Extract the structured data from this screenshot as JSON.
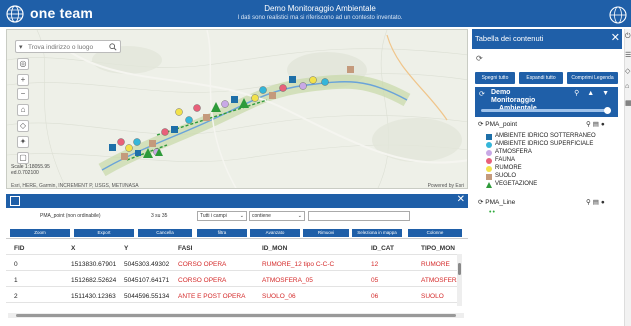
{
  "header": {
    "brand": "one team",
    "title": "Demo Monitoraggio Ambientale",
    "subtitle": "I dati sono realistici ma si riferiscono ad un contesto inventato."
  },
  "map": {
    "search_placeholder": "Trova indirizzo o luogo",
    "scale_text": "Scale 1:18055.95",
    "scale_sub": "ed.0.702100",
    "attribution": "Esri, HERE, Garmin, INCREMENT P, USGS, METI/NASA",
    "powered_by": "Powered by Esri"
  },
  "toc": {
    "title": "Tabella dei contenuti",
    "buttons": [
      "Spegni tutto",
      "Espandi tutto",
      "Comprimi Legenda"
    ],
    "group_name_line1": "Demo Monitoraggio",
    "group_name_line2": "Ambientale",
    "point_layer": "PMA_point",
    "line_layer": "PMA_Line",
    "legend": [
      {
        "label": "AMBIENTE IDRICO SOTTERRANEO",
        "color": "#1e6fa8",
        "shape": "square"
      },
      {
        "label": "AMBIENTE IDRICO SUPERFICIALE",
        "color": "#35b6d9",
        "shape": "circle"
      },
      {
        "label": "ATMOSFERA",
        "color": "#c9a9e6",
        "shape": "circle"
      },
      {
        "label": "FAUNA",
        "color": "#e8607a",
        "shape": "circle"
      },
      {
        "label": "RUMORE",
        "color": "#f2e24b",
        "shape": "circle"
      },
      {
        "label": "SUOLO",
        "color": "#c49a7c",
        "shape": "square"
      },
      {
        "label": "VEGETAZIONE",
        "color": "#2e9a3a",
        "shape": "triangle"
      }
    ]
  },
  "attr": {
    "layer_label": "PMA_point (non ordinabile)",
    "count": "3 su 35",
    "select_fields": "Tutti i campi",
    "select_op": "contiene",
    "buttons": [
      "Zoom",
      "Export",
      "Cancella",
      "filtra",
      "Avanzato",
      "Rimuovi",
      "Seleziona in mappa",
      "Colonne"
    ],
    "columns": [
      "FID",
      "X",
      "Y",
      "FASI",
      "ID_MON",
      "ID_CAT",
      "TIPO_MON"
    ],
    "rows": [
      [
        "0",
        "1513830.67901",
        "5045303.49302",
        "CORSO OPERA",
        "RUMORE_12 tipo C-C-C",
        "12",
        "RUMORE"
      ],
      [
        "1",
        "1512682.52624",
        "5045107.64171",
        "CORSO OPERA",
        "ATMOSFERA_05",
        "05",
        "ATMOSFERA"
      ],
      [
        "2",
        "1511430.12363",
        "5044596.55134",
        "ANTE E POST OPERA",
        "SUOLO_06",
        "06",
        "SUOLO"
      ]
    ]
  }
}
